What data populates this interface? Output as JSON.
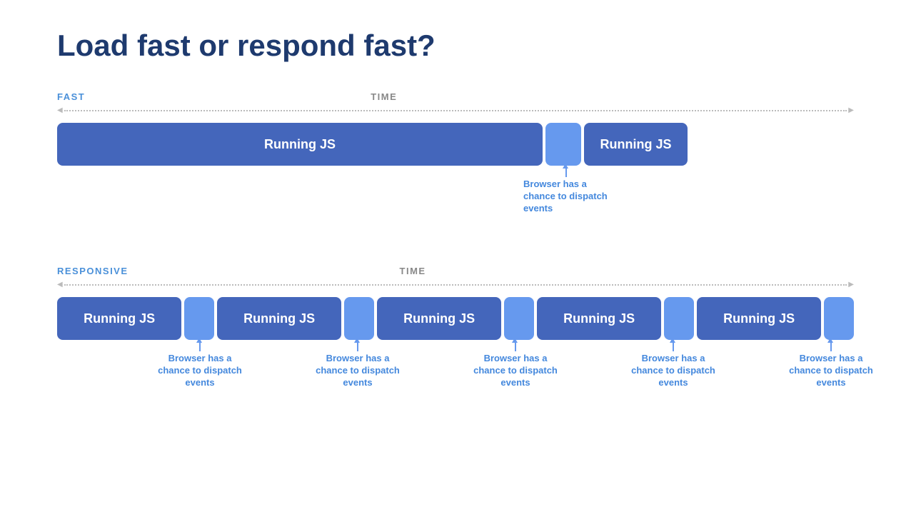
{
  "title": "Load fast or respond fast?",
  "fast_section": {
    "label": "FAST",
    "time_label": "TIME",
    "running_js_1": "Running JS",
    "running_js_2": "Running JS",
    "annotation": "Browser has a chance to dispatch events"
  },
  "responsive_section": {
    "label": "RESPONSIVE",
    "time_label": "TIME",
    "running_js": "Running JS",
    "annotations": [
      "Browser has a chance to dispatch events",
      "Browser has a chance to dispatch events",
      "Browser has a chance to dispatch events",
      "Browser has a chance to dispatch events",
      "Browser has a chance to dispatch events"
    ]
  },
  "colors": {
    "dark_blue": "#3d5fa0",
    "light_blue": "#6699ee",
    "text_blue": "#4488dd",
    "label_blue": "#4a90d9",
    "heading": "#1e3a6e",
    "time": "#888888",
    "arrow": "#bbbbbb"
  }
}
